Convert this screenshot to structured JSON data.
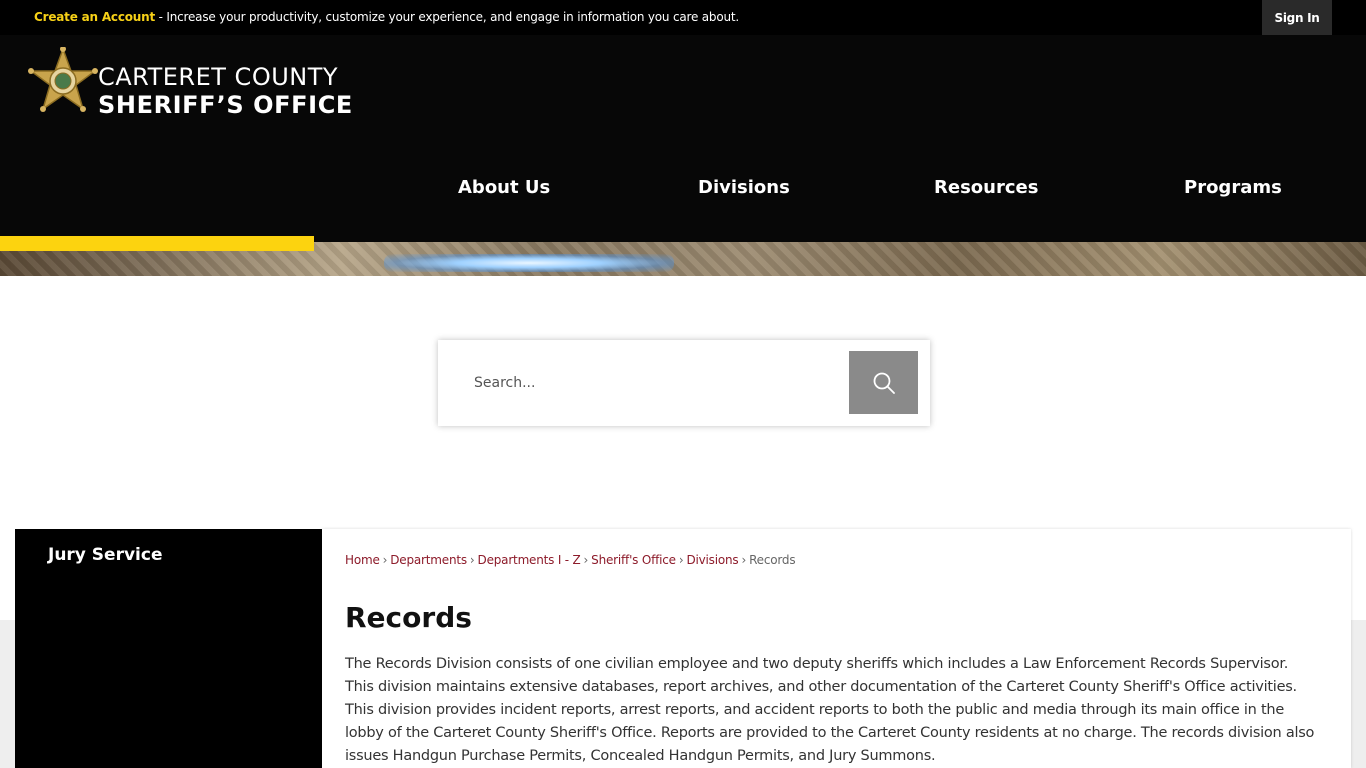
{
  "topbar": {
    "create_account": "Create an Account",
    "message": " - Increase your productivity, customize your experience, and engage in information you care about.",
    "sign_in": "Sign In"
  },
  "logo": {
    "line1": "CARTERET COUNTY",
    "line2": "SHERIFF’S OFFICE"
  },
  "nav": {
    "items": [
      {
        "label": "About Us"
      },
      {
        "label": "Divisions"
      },
      {
        "label": "Resources"
      },
      {
        "label": "Programs"
      }
    ]
  },
  "search": {
    "placeholder": "Search..."
  },
  "sidebar": {
    "items": [
      {
        "label": "Jury Service"
      }
    ]
  },
  "breadcrumb": {
    "items": [
      "Home",
      "Departments",
      "Departments I - Z",
      "Sheriff's Office",
      "Divisions"
    ],
    "separator": "›",
    "current": "Records"
  },
  "page": {
    "title": "Records",
    "body": "The Records Division consists of one civilian employee and two deputy sheriffs which includes a Law Enforcement Records Supervisor. This division maintains extensive databases, report archives, and other documentation of the Carteret County Sheriff's Office activities. This division provides incident reports, arrest reports, and accident reports to both the public and media through its main office in the lobby of the Carteret County Sheriff's Office. Reports are provided to the Carteret County residents at no charge. The records division also issues Handgun Purchase Permits, Concealed Handgun Permits, and Jury Summons."
  },
  "colors": {
    "accent_yellow": "#fcd30f",
    "header_black": "#070707",
    "link_maroon": "#8d1b2a",
    "search_button": "#8a8a8a"
  },
  "icons": {
    "logo": "sheriff-star-badge-icon",
    "search": "magnifier-icon"
  }
}
